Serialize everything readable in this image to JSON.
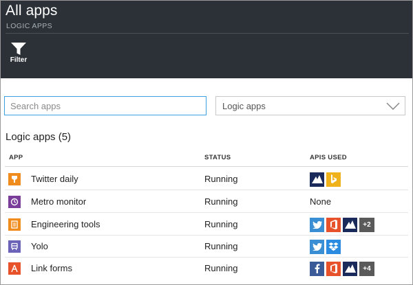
{
  "header": {
    "title": "All apps",
    "subtitle": "LOGIC APPS",
    "filter_label": "Filter"
  },
  "search": {
    "placeholder": "Search apps",
    "value": ""
  },
  "type_select": {
    "value": "Logic apps"
  },
  "section_title": "Logic apps (5)",
  "columns": {
    "app": "APP",
    "status": "STATUS",
    "apis": "APIS USED"
  },
  "rows": [
    {
      "name": "Twitter daily",
      "status": "Running",
      "icon": "logic-app-icon",
      "icon_color": "#f08c1e",
      "apis": [
        "azure-icon",
        "bing-icon"
      ],
      "more": ""
    },
    {
      "name": "Metro monitor",
      "status": "Running",
      "icon": "logic-app-icon",
      "icon_color": "#7a3e9a",
      "apis_text": "None",
      "apis": [],
      "more": ""
    },
    {
      "name": "Engineering tools",
      "status": "Running",
      "icon": "logic-app-icon",
      "icon_color": "#f08c1e",
      "apis": [
        "twitter-icon",
        "office-icon",
        "azure-icon"
      ],
      "more": "+2"
    },
    {
      "name": "Yolo",
      "status": "Running",
      "icon": "logic-app-icon",
      "icon_color": "#6a63b8",
      "apis": [
        "twitter-icon",
        "dropbox-icon"
      ],
      "more": ""
    },
    {
      "name": "Link forms",
      "status": "Running",
      "icon": "logic-app-icon",
      "icon_color": "#e8522a",
      "apis": [
        "facebook-icon",
        "office-icon",
        "azure-icon"
      ],
      "more": "+4"
    }
  ],
  "colors": {
    "header_bg": "#2b3137",
    "focus_border": "#3aa0e0",
    "twitter": "#3a8fd4",
    "bing": "#f0b21a",
    "office": "#e8522a",
    "azure": "#1a2a5a",
    "facebook": "#3b5a98",
    "dropbox": "#2a8be0",
    "more_badge": "#5a5a5a"
  }
}
